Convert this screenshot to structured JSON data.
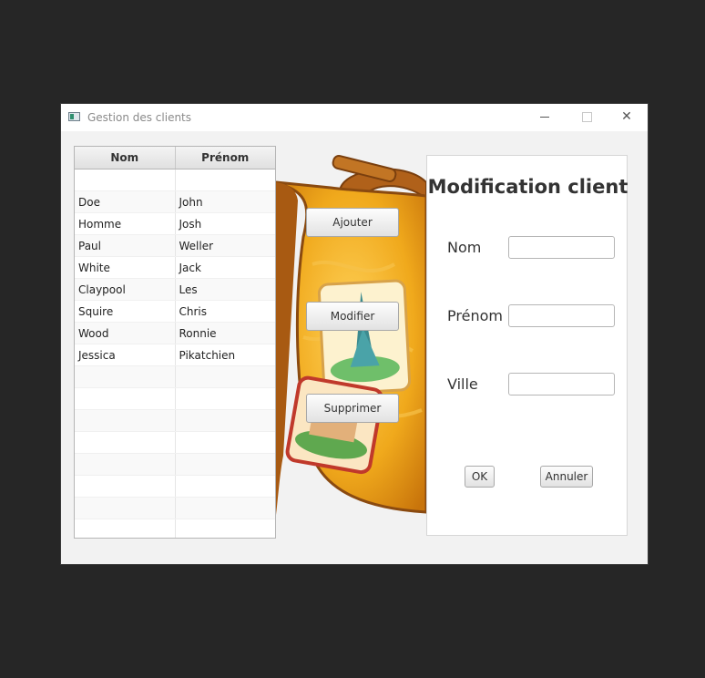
{
  "window": {
    "title": "Gestion des clients"
  },
  "table": {
    "columns": [
      "Nom",
      "Prénom"
    ],
    "rows": [
      [
        "",
        ""
      ],
      [
        "Doe",
        "John"
      ],
      [
        "Homme",
        "Josh"
      ],
      [
        "Paul",
        "Weller"
      ],
      [
        "White",
        "Jack"
      ],
      [
        "Claypool",
        "Les"
      ],
      [
        "Squire",
        "Chris"
      ],
      [
        "Wood",
        "Ronnie"
      ],
      [
        "Jessica",
        "Pikatchien"
      ],
      [
        "",
        ""
      ],
      [
        "",
        ""
      ],
      [
        "",
        ""
      ],
      [
        "",
        ""
      ],
      [
        "",
        ""
      ],
      [
        "",
        ""
      ],
      [
        "",
        ""
      ],
      [
        "",
        ""
      ]
    ]
  },
  "actions": {
    "add": "Ajouter",
    "edit": "Modifier",
    "delete": "Supprimer"
  },
  "form": {
    "title": "Modification client",
    "nom_label": "Nom",
    "nom_value": "",
    "prenom_label": "Prénom",
    "prenom_value": "",
    "ville_label": "Ville",
    "ville_value": "",
    "ok": "OK",
    "cancel": "Annuler"
  }
}
